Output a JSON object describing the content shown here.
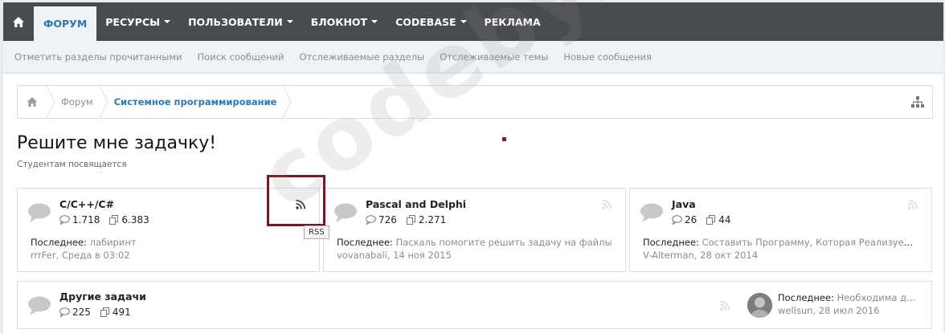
{
  "topnav": {
    "items": [
      {
        "label": "ФОРУМ",
        "active": true,
        "dropdown": false
      },
      {
        "label": "РЕСУРСЫ",
        "dropdown": true
      },
      {
        "label": "ПОЛЬЗОВАТЕЛИ",
        "dropdown": true
      },
      {
        "label": "БЛОКНОТ",
        "dropdown": true
      },
      {
        "label": "CODEBASE",
        "dropdown": true
      },
      {
        "label": "РЕКЛАМА",
        "dropdown": false
      }
    ]
  },
  "subnav": {
    "items": [
      "Отметить разделы прочитанными",
      "Поиск сообщений",
      "Отслеживаемые разделы",
      "Отслеживаемые темы",
      "Новые сообщения"
    ]
  },
  "breadcrumb": {
    "items": [
      "Форум",
      "Системное программирование"
    ]
  },
  "page": {
    "title": "Решите мне задачку!",
    "description": "Студентам посвящается"
  },
  "forums": [
    {
      "name": "C/C++/C#",
      "threads": "1.718",
      "messages": "6.383",
      "last_label": "Последнее:",
      "last_thread": "лабиринт",
      "last_user": "rrrFer",
      "last_date": "Среда в 03:02"
    },
    {
      "name": "Pascal and Delphi",
      "threads": "726",
      "messages": "2.271",
      "last_label": "Последнее:",
      "last_thread": "Паскаль помогите решить задачу на файлы",
      "last_user": "vovanabali",
      "last_date": "14 ноя 2015"
    },
    {
      "name": "Java",
      "threads": "26",
      "messages": "44",
      "last_label": "Последнее:",
      "last_thread": "Составить Программу, Которая Реализует...",
      "last_user": "V-Alterman",
      "last_date": "28 окт 2014"
    },
    {
      "name": "Другие задачи",
      "threads": "225",
      "messages": "491",
      "last_label": "Последнее:",
      "last_thread": "Необходима д...",
      "last_user": "wellsun",
      "last_date": "28 июл 2016"
    }
  ],
  "tooltip": "RSS",
  "watermark": "codeby.net",
  "colors": {
    "nav_bg": "#484b4f",
    "accent": "#2c78b0",
    "highlight": "#7b1525"
  }
}
